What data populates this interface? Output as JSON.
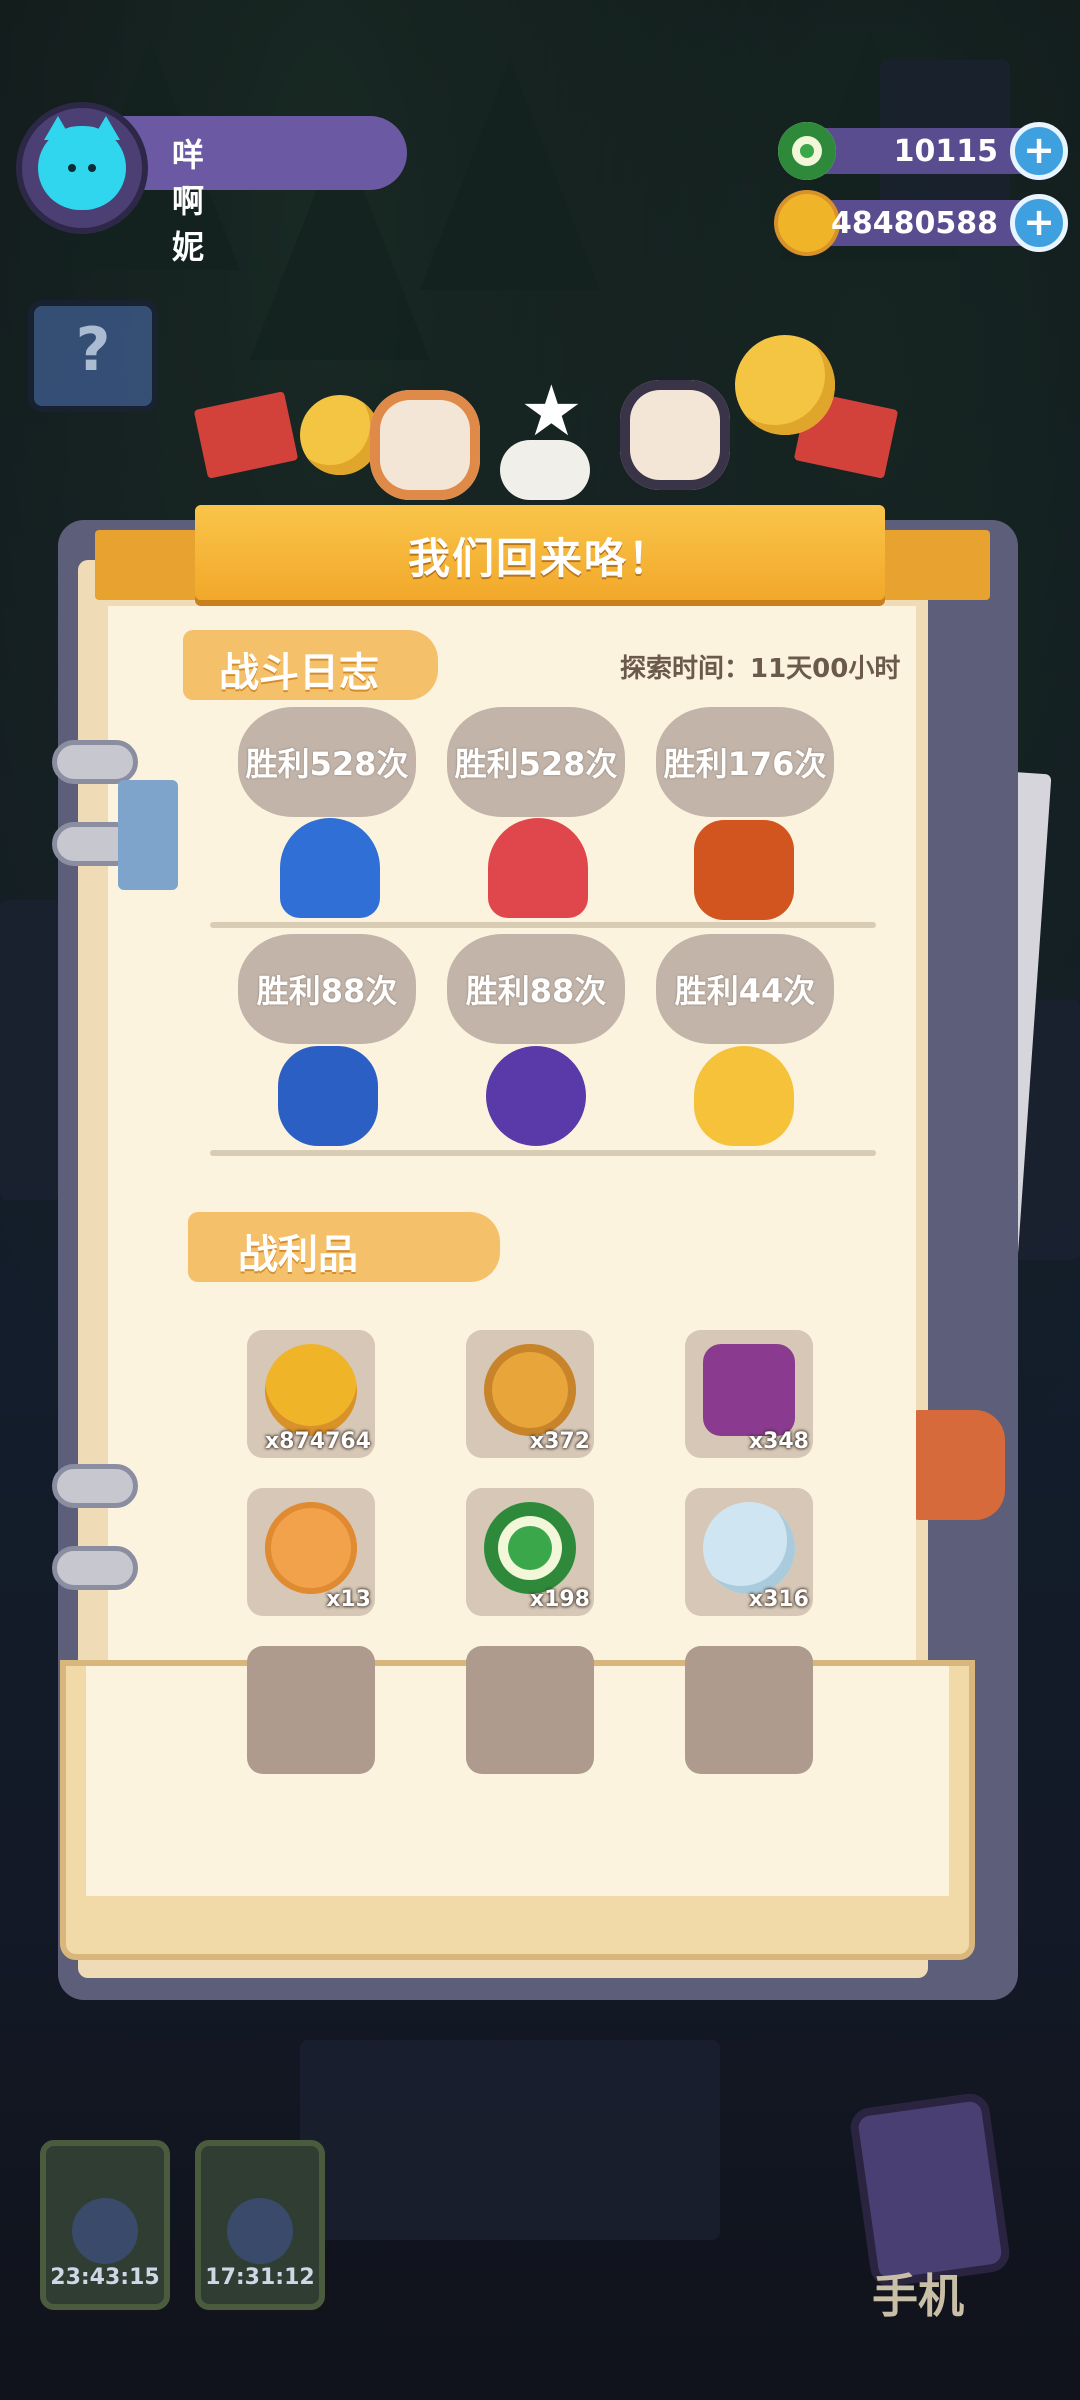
{
  "player": {
    "name": "咩啊妮",
    "avatar_icon": "cat-avatar-icon"
  },
  "currencies": [
    {
      "icon": "green-donut-coin-icon",
      "value": "10115",
      "color": "#3aa84a"
    },
    {
      "icon": "gold-planet-coin-icon",
      "value": "48480588",
      "color": "#f0b429"
    }
  ],
  "dialog": {
    "title": "我们回来咯！",
    "battle_log": {
      "heading": "战斗日志",
      "explore_time": "探索时间：11天00小时",
      "entries": [
        {
          "result": "胜利528次",
          "monster_icon": "blue-mushroom-monster-icon",
          "color": "#2f6fd6"
        },
        {
          "result": "胜利528次",
          "monster_icon": "red-mushroom-monster-icon",
          "color": "#e0474c"
        },
        {
          "result": "胜利176次",
          "monster_icon": "orange-fire-beast-icon",
          "color": "#d2541e"
        },
        {
          "result": "胜利88次",
          "monster_icon": "blue-horned-beast-icon",
          "color": "#2b5fc4"
        },
        {
          "result": "胜利88次",
          "monster_icon": "purple-ghost-cat-icon",
          "color": "#5a3aa8"
        },
        {
          "result": "胜利44次",
          "monster_icon": "yellow-bat-spirit-icon",
          "color": "#f5c23a"
        }
      ]
    },
    "loot": {
      "heading": "战利品",
      "items": [
        {
          "icon": "gold-planet-coin-icon",
          "count": "x874764",
          "color": "#f0b429"
        },
        {
          "icon": "bronze-cat-coin-icon",
          "count": "x372",
          "color": "#e8a53a"
        },
        {
          "icon": "purple-charm-bag-icon",
          "count": "x348",
          "color": "#8a3b8f"
        },
        {
          "icon": "mooncake-icon",
          "count": "x13",
          "color": "#f2a24a"
        },
        {
          "icon": "green-donut-coin-icon",
          "count": "x198",
          "color": "#3aa84a"
        },
        {
          "icon": "crystal-bubble-icon",
          "count": "x316",
          "color": "#cfe6f2"
        },
        {
          "icon": "",
          "count": ""
        },
        {
          "icon": "",
          "count": ""
        },
        {
          "icon": "",
          "count": ""
        }
      ]
    }
  },
  "bottom": {
    "timers": [
      {
        "time": "23:43:15"
      },
      {
        "time": "17:31:12"
      }
    ],
    "phone_label": "手机"
  }
}
